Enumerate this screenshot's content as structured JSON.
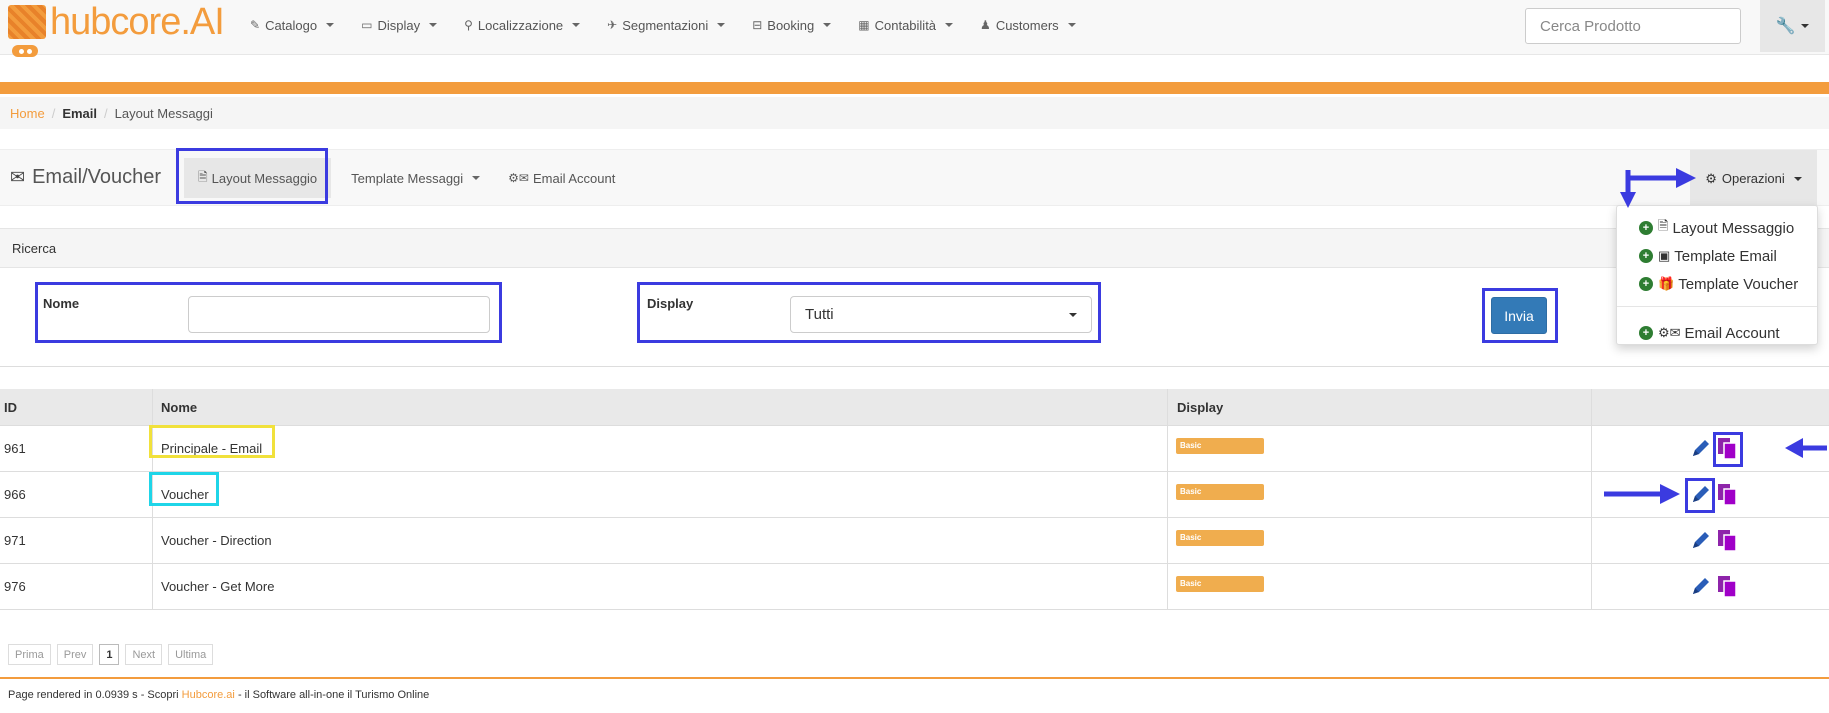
{
  "app": {
    "logo_text": "hubcore.AI",
    "accent_color": "#f39c3d",
    "highlight_color": "#3b3be0"
  },
  "navbar": {
    "items": [
      {
        "icon": "edit-icon",
        "label": "Catalogo"
      },
      {
        "icon": "monitor-icon",
        "label": "Display"
      },
      {
        "icon": "map-marker-icon",
        "label": "Localizzazione"
      },
      {
        "icon": "pushpin-icon",
        "label": "Segmentazioni"
      },
      {
        "icon": "cart-icon",
        "label": "Booking"
      },
      {
        "icon": "calculator-icon",
        "label": "Contabilità"
      },
      {
        "icon": "user-icon",
        "label": "Customers"
      }
    ],
    "search_placeholder": "Cerca Prodotto",
    "tools_icon": "wrench-icon"
  },
  "breadcrumb": {
    "home": "Home",
    "section": "Email",
    "current": "Layout Messaggi"
  },
  "subheader": {
    "brand": "Email/Voucher",
    "tabs": [
      {
        "label": "Layout Messaggio",
        "icon": "file-icon",
        "active": true
      },
      {
        "label": "Template Messaggi",
        "icon": "",
        "active": false,
        "dropdown": true
      },
      {
        "label": "Email Account",
        "icon": "gears-envelope-icon",
        "active": false
      }
    ],
    "operations_label": "Operazioni"
  },
  "operations_menu": {
    "items": [
      {
        "label": "Layout Messaggio",
        "icon": "file-icon"
      },
      {
        "label": "Template Email",
        "icon": "square-icon"
      },
      {
        "label": "Template Voucher",
        "icon": "gift-icon"
      },
      {
        "label": "Email Account",
        "icon": "gears-envelope-icon"
      }
    ]
  },
  "search_panel": {
    "title": "Ricerca",
    "nome_label": "Nome",
    "nome_value": "",
    "display_label": "Display",
    "display_value": "Tutti",
    "submit_label": "Invia"
  },
  "table": {
    "columns": [
      "ID",
      "Nome",
      "Display",
      ""
    ],
    "rows": [
      {
        "id": "961",
        "nome": "Principale - Email",
        "display": "Basic"
      },
      {
        "id": "966",
        "nome": "Voucher",
        "display": "Basic"
      },
      {
        "id": "971",
        "nome": "Voucher - Direction",
        "display": "Basic"
      },
      {
        "id": "976",
        "nome": "Voucher - Get More",
        "display": "Basic"
      }
    ],
    "action_icons": [
      "pencil-icon",
      "copy-icon"
    ],
    "badge_color": "#f0ad4e"
  },
  "pagination": {
    "first": "Prima",
    "prev": "Prev",
    "current": "1",
    "next": "Next",
    "last": "Ultima"
  },
  "footer": {
    "prefix": "Page rendered in 0.0939 s - Scopri",
    "link": "Hubcore.ai",
    "suffix": "- il Software all-in-one il Turismo Online"
  }
}
